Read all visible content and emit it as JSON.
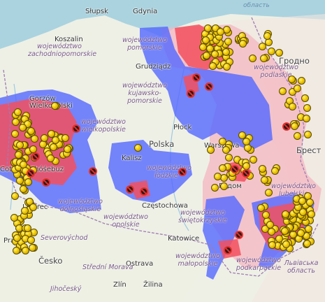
{
  "map": {
    "cities": [
      "Słupsk",
      "Gdynia",
      "Koszalin",
      "Grudziądz",
      "Gorzów Wielkopolski",
      "Płock",
      "Cottbus/Chóśebuz",
      "Kalisz",
      "Warszawa",
      "Радом",
      "Częstochowa",
      "Liberec",
      "Katowice",
      "Praha",
      "Ostrava",
      "Zlín",
      "Žilina",
      "Jihočeský"
    ],
    "regions": [
      "województwo pomorskie",
      "województwo zachodniopomorskie",
      "województwo kujawsko-pomorskie",
      "województwo podlaskie",
      "województwo wielkopolskie",
      "województwo łódzkie",
      "województwo lubelskie",
      "województwo dolnośląskie",
      "województwo opolskie",
      "województwo świętokrzyskie",
      "województwo małopolskie",
      "województwo podkarpackie",
      "Severovýchod",
      "Střední Morava"
    ],
    "countries": [
      "Polska",
      "Česko",
      "Гродно",
      "Брест",
      "Львівська область"
    ],
    "sea": "область",
    "legend": {
      "zone_blue": "#5468ff",
      "zone_red": "#f3505e",
      "zone_pink": "#f4b6c0",
      "marker": "#f5d100",
      "case_marker": "#e4312d"
    }
  }
}
